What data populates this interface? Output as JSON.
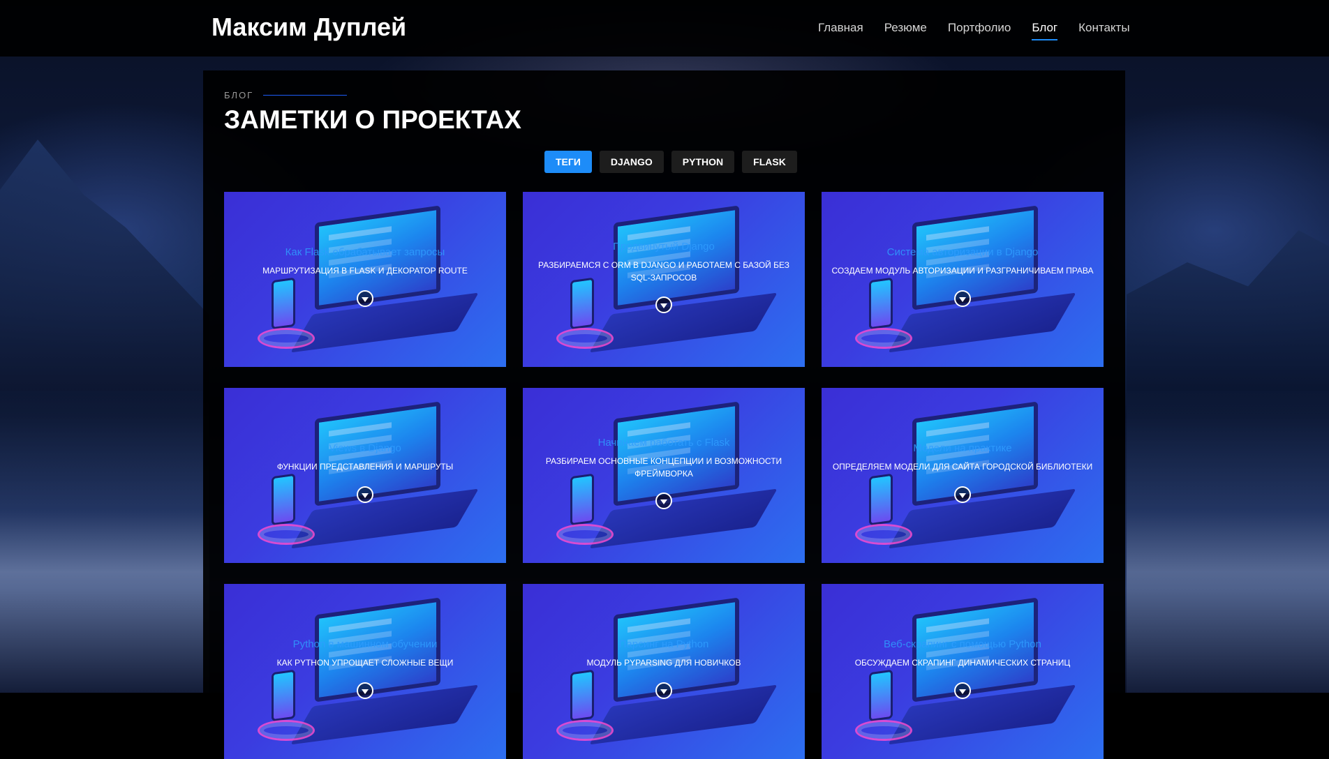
{
  "site": {
    "brand": "Максим Дуплей"
  },
  "nav": [
    {
      "label": "Главная"
    },
    {
      "label": "Резюме"
    },
    {
      "label": "Портфолио"
    },
    {
      "label": "Блог",
      "active": true
    },
    {
      "label": "Контакты"
    }
  ],
  "section": {
    "label": "БЛОГ",
    "title": "ЗАМЕТКИ О ПРОЕКТАХ"
  },
  "filters": [
    {
      "label": "ТЕГИ",
      "active": true
    },
    {
      "label": "DJANGO"
    },
    {
      "label": "PYTHON"
    },
    {
      "label": "FLASK"
    }
  ],
  "posts": [
    {
      "title": "Как Flask обрабатывает запросы",
      "description": "Маршрутизация в Flask и декоратор route"
    },
    {
      "title": "Продвинутый Django",
      "description": "Разбираемся с ORM в Django и работаем с базой без SQL-запросов"
    },
    {
      "title": "Система авторизации в Django",
      "description": "Создаем модуль авторизации и разграничиваем права"
    },
    {
      "title": "Views в Django",
      "description": "Функции представления и маршруты"
    },
    {
      "title": "Начинаем работать с Flask",
      "description": "Разбираем основные концепции и возможности фреймворка"
    },
    {
      "title": "Модели на практике",
      "description": "Определяем модели для сайта городской библиотеки"
    },
    {
      "title": "Python в машинном обучении",
      "description": "Как Python упрощает сложные вещи"
    },
    {
      "title": "Парсинг на Python",
      "description": "Модуль pyparsing для новичков"
    },
    {
      "title": "Веб-скрапинг с помощью Python",
      "description": "Обсуждаем скрапинг динамических страниц"
    }
  ],
  "colors": {
    "accent": "#1d8cf8",
    "panel": "#000000",
    "card": "#3a3fe0"
  }
}
